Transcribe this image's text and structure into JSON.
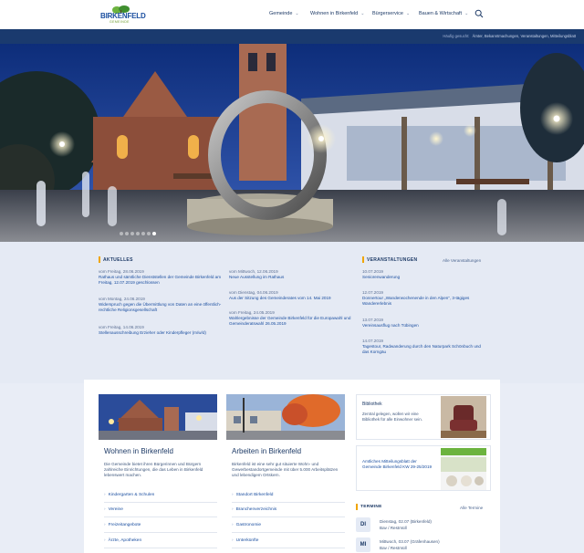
{
  "logo": {
    "name": "BIRKENFELD",
    "sub": "GEMEINDE"
  },
  "nav": [
    {
      "label": "Gemeinde"
    },
    {
      "label": "Wohnen in Birkenfeld"
    },
    {
      "label": "Bürgerservice"
    },
    {
      "label": "Bauen & Wirtschaft"
    }
  ],
  "quicklinks": {
    "label": "Häufig gesucht:",
    "items": "Ämter, Bekanntmachungen, Veranstaltungen, Mitteilungsblatt"
  },
  "slider": {
    "count": 7,
    "active": 6
  },
  "aktuelles": {
    "title": "AKTUELLES",
    "col1": [
      {
        "date": "vom Freitag, 28.06.2019",
        "title": "Rathaus und sämtliche Dienststellen der Gemeinde Birkenfeld am Freitag, 12.07.2019 geschlossen"
      },
      {
        "date": "vom Montag, 24.06.2019",
        "title": "Widerspruch gegen die Übermittlung von Daten an eine öffentlich-rechtliche Religionsgesellschaft"
      },
      {
        "date": "vom Freitag, 14.06.2019",
        "title": "Stellenausschreibung Erzieher oder Kinderpfleger (m/w/d)"
      }
    ],
    "col2": [
      {
        "date": "vom Mittwoch, 12.06.2019",
        "title": "Neue Ausstellung im Rathaus"
      },
      {
        "date": "vom Dienstag, 04.06.2019",
        "title": "Aus der Sitzung des Gemeinderates vom 14. Mai 2019"
      },
      {
        "date": "vom Freitag, 24.05.2019",
        "title": "Wahlergebnisse der Gemeinde Birkenfeld für die Europawahl und Gemeinderatswahl 26.05.2019"
      }
    ]
  },
  "veranstaltungen": {
    "title": "VERANSTALTUNGEN",
    "all_label": "Alle Veranstaltungen",
    "items": [
      {
        "date": "10.07.2019",
        "title": "Seniorenwanderung"
      },
      {
        "date": "12.07.2019",
        "title": "Donnertour „Wanderwochenende in den Alpen“, 3-tägiges Wandererlebnis"
      },
      {
        "date": "13.07.2019",
        "title": "Vereinsausflug nach Tübingen"
      },
      {
        "date": "14.07.2019",
        "title": "Tagestour, Radwanderung durch den Naturpark Schönbuch und das Korngäu"
      }
    ]
  },
  "wohnen": {
    "title": "Wohnen in Birkenfeld",
    "text": "Die Gemeinde bietet ihren Bürgerinnen und Bürgern zahlreiche Einrichtungen, die das Leben in Birkenfeld lebenswert machen.",
    "links": [
      "Kindergarten & Schulen",
      "Vereine",
      "Freizeitangebote",
      "Ärzte, Apotheken"
    ]
  },
  "arbeiten": {
    "title": "Arbeiten in Birkenfeld",
    "text": "Birkenfeld ist eine sehr gut situierte Wohn- und Gewerbestandortgemeinde mit über 5.000 Arbeitsplätzen und lebendigem Ortskern.",
    "links": [
      "Standort Birkenfeld",
      "Branchenverzeichnis",
      "Gastronomie",
      "Unterkünfte"
    ]
  },
  "bibliothek": {
    "title": "Bibliothek",
    "text": "Zentral gelegen, wollen wir eine Bibliothek für alle Einwohner sein."
  },
  "mitteilungsblatt": {
    "text": "Amtliches Mitteilungsblatt der Gemeinde Birkenfeld KW 29-25/2019"
  },
  "termine": {
    "title": "TERMINE",
    "all_label": "Alle Termine",
    "items": [
      {
        "day": "DI",
        "when": "Dienstag, 02.07 (Birkenfeld)",
        "where": "Bav / Restmüll"
      },
      {
        "day": "MI",
        "when": "Mittwoch, 03.07 (Gräfenhausen)",
        "where": "Bav / Restmüll"
      }
    ]
  },
  "colors": {
    "primary": "#1a3a6e",
    "accent": "#f0a500",
    "link": "#1b4fa0"
  }
}
